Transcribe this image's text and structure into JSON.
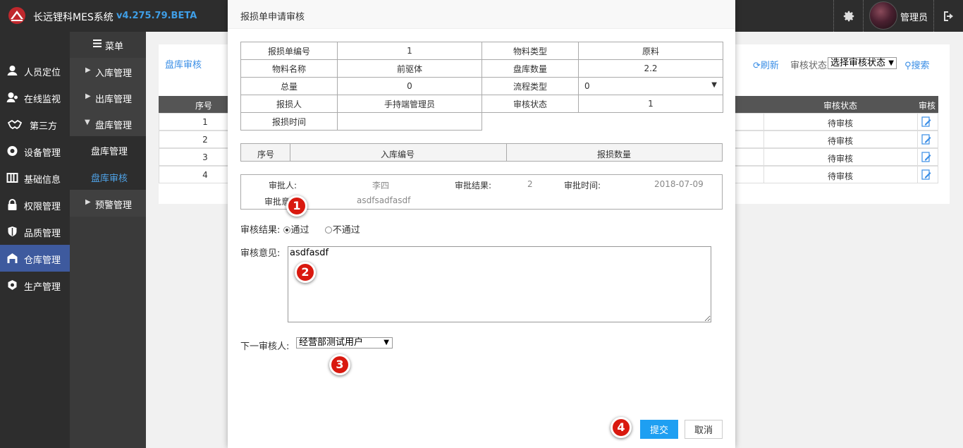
{
  "app": {
    "title": "长远锂科MES系统",
    "version": "v4.275.79.BETA",
    "user": "管理员"
  },
  "leftnav": {
    "items": [
      {
        "label": "人员定位",
        "icon": "person-pin-icon"
      },
      {
        "label": "在线监视",
        "icon": "monitor-icon"
      },
      {
        "label": "第三方",
        "icon": "handshake-icon"
      },
      {
        "label": "设备管理",
        "icon": "device-icon"
      },
      {
        "label": "基础信息",
        "icon": "grid-icon"
      },
      {
        "label": "权限管理",
        "icon": "lock-icon"
      },
      {
        "label": "品质管理",
        "icon": "shield-icon"
      },
      {
        "label": "仓库管理",
        "icon": "warehouse-icon"
      },
      {
        "label": "生产管理",
        "icon": "production-icon"
      }
    ],
    "active_index": 7
  },
  "submenu": {
    "header": "菜单",
    "items": [
      {
        "label": "入库管理"
      },
      {
        "label": "出库管理"
      },
      {
        "label": "盘库管理"
      }
    ],
    "children": [
      {
        "label": "盘库管理"
      },
      {
        "label": "盘库审核"
      }
    ],
    "after": {
      "label": "预警管理"
    }
  },
  "page": {
    "breadcrumb": "盘库审核",
    "refresh": "刷新",
    "status_label": "审核状态",
    "status_select": "选择审核状态",
    "search": "搜索",
    "table": {
      "headers": [
        "序号",
        "审核状态",
        "审核"
      ],
      "rows": [
        {
          "idx": "1",
          "status": "待审核"
        },
        {
          "idx": "2",
          "status": "待审核"
        },
        {
          "idx": "3",
          "status": "待审核"
        },
        {
          "idx": "4",
          "status": "待审核"
        }
      ]
    }
  },
  "modal": {
    "title": "报损单申请审核",
    "info": {
      "labels": {
        "order_no": "报损单编号",
        "material_type": "物料类型",
        "material_name": "物料名称",
        "inventory_qty": "盘库数量",
        "total": "总量",
        "flow_type": "流程类型",
        "reporter": "报损人",
        "audit_status": "审核状态",
        "report_time": "报损时间"
      },
      "values": {
        "order_no": "1",
        "material_type": "原料",
        "material_name": "前驱体",
        "inventory_qty": "2.2",
        "total": "0",
        "flow_type": "0",
        "reporter": "手持端管理员",
        "audit_status": "1",
        "report_time": ""
      }
    },
    "detail_headers": [
      "序号",
      "入库编号",
      "报损数量"
    ],
    "approval": {
      "approver_label": "审批人:",
      "approver": "李四",
      "result_label": "审批结果:",
      "result": "2",
      "time_label": "审批时间:",
      "time": "2018-07-09",
      "opinion_label": "审批意见:",
      "opinion": "asdfsadfasdf"
    },
    "audit_result": {
      "label": "审核结果:",
      "options": [
        "通过",
        "不通过"
      ],
      "selected": "通过"
    },
    "opinion": {
      "label": "审核意见:",
      "value": "asdfasdf"
    },
    "next_reviewer": {
      "label": "下一审核人:",
      "value": "经营部测试用户"
    },
    "buttons": {
      "submit": "提交",
      "cancel": "取消"
    }
  },
  "markers": [
    "1",
    "2",
    "3",
    "4"
  ],
  "colors": {
    "accent": "#1e9ff2",
    "marker": "#d9190f",
    "nav_active": "#3e5a9e",
    "link": "#3a8ee6"
  }
}
